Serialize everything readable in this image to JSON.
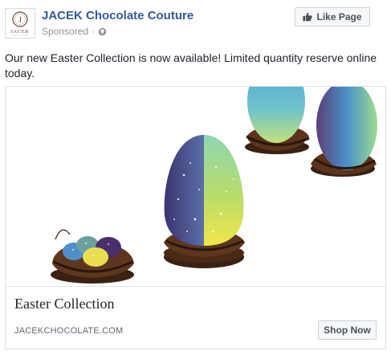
{
  "post": {
    "page_name": "JACEK Chocolate Couture",
    "sponsored_label": "Sponsored",
    "separator": "·",
    "privacy_icon": "globe-icon",
    "like_button_label": "Like Page",
    "like_button_icon": "thumbs-up-icon",
    "message": "Our new Easter Collection is now available! Limited quantity reserve online today.",
    "avatar": {
      "logo_icon": "jacek-logo-icon",
      "wordmark": "JACEK"
    }
  },
  "attachment": {
    "image_icon": "easter-eggs-photo",
    "title": "Easter Collection",
    "domain": "JACEKCHOCOLATE.COM",
    "cta_label": "Shop Now"
  },
  "colors": {
    "link_blue": "#365899",
    "text": "#1d2129",
    "meta_gray": "#90949c",
    "border": "#dddfe2",
    "button_bg": "#f6f7f9"
  }
}
